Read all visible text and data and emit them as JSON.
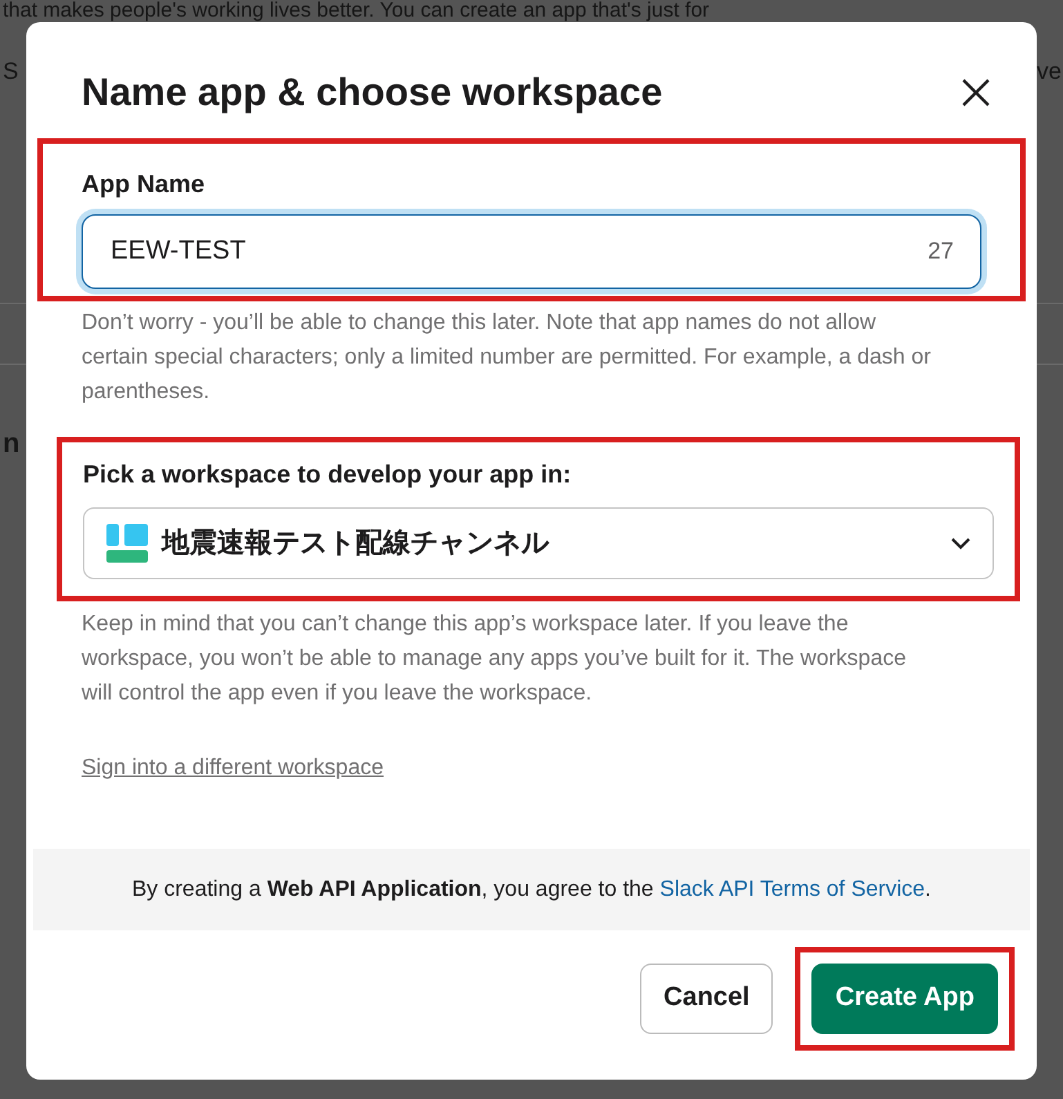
{
  "background": {
    "top_line": "that makes people's working lives better. You can create an app that's just for",
    "left_fragment": "S",
    "right_fragment": "ve",
    "side_heading_fragment": "n"
  },
  "dialog": {
    "title": "Name app & choose workspace",
    "app_name": {
      "label": "App Name",
      "value": "EEW-TEST",
      "counter": "27",
      "focused": true,
      "highlighted": true,
      "help": "Don’t worry - you’ll be able to change this later. Note that app names do not allow certain special characters; only a limited number are permitted. For example, a dash or parentheses."
    },
    "workspace": {
      "label": "Pick a workspace to develop your app in:",
      "value": "地震速報テスト配線チャンネル",
      "highlighted": true,
      "help": "Keep in mind that you can’t change this app’s workspace later. If you leave the workspace, you won’t be able to manage any apps you’ve built for it. The workspace will control the app even if you leave the workspace."
    },
    "sign_in_link": "Sign into a different workspace",
    "notice": {
      "before": "By creating a **Web API Application**, you agree to the",
      "link": "Slack API Terms of Service",
      "after": "."
    },
    "buttons": [
      {
        "label": "Cancel",
        "kind": "secondary",
        "highlighted": false
      },
      {
        "label": "Create App",
        "kind": "primary",
        "highlighted": true
      }
    ]
  }
}
